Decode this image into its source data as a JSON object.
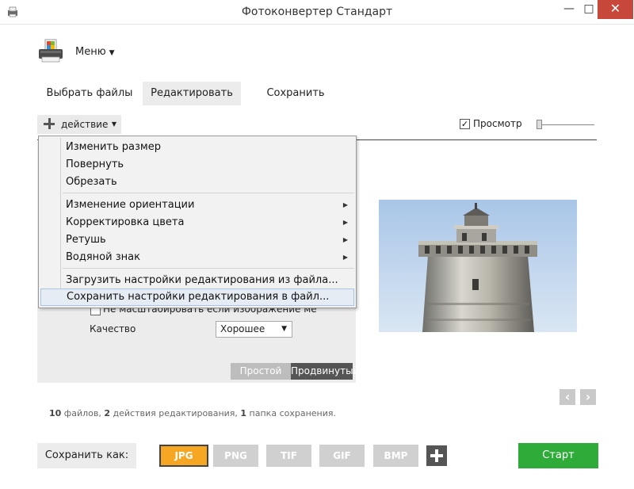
{
  "window": {
    "title": "Фотоконвертер Стандарт",
    "minimize_glyph": "—",
    "maximize_glyph": "□",
    "close_glyph": "✕"
  },
  "header": {
    "menu_label": "Меню",
    "menu_caret": "▼"
  },
  "tabs": [
    {
      "label": "Выбрать файлы",
      "active": false
    },
    {
      "label": "Редактировать",
      "active": true
    },
    {
      "label": "Сохранить",
      "active": false
    }
  ],
  "toolbar": {
    "action_label": "действие",
    "action_caret": "▼",
    "preview_label": "Просмотр",
    "preview_checked": true,
    "preview_check_glyph": "✓"
  },
  "action_menu": {
    "groups": [
      [
        {
          "label": "Изменить размер",
          "submenu": false
        },
        {
          "label": "Повернуть",
          "submenu": false
        },
        {
          "label": "Обрезать",
          "submenu": false
        }
      ],
      [
        {
          "label": "Изменение ориентации",
          "submenu": true
        },
        {
          "label": "Корректировка цвета",
          "submenu": true
        },
        {
          "label": "Ретушь",
          "submenu": true
        },
        {
          "label": "Водяной знак",
          "submenu": true
        }
      ],
      [
        {
          "label": "Загрузить настройки редактирования из файла...",
          "submenu": false
        },
        {
          "label": "Сохранить настройки редактирования в файл...",
          "submenu": false,
          "highlighted": true
        }
      ]
    ],
    "submenu_arrow": "▶"
  },
  "settings": {
    "noscale_label": "Не масштабировать если изображение ме",
    "noscale_checked": false,
    "quality_label": "Качество",
    "quality_value": "Хорошее",
    "quality_caret": "▼",
    "mode_simple": "Простой",
    "mode_advanced": "Продвинутый"
  },
  "nav": {
    "prev_glyph": "‹",
    "next_glyph": "›"
  },
  "summary": {
    "files_count": "10",
    "files_text": " файлов, ",
    "actions_count": "2",
    "actions_text": " действия редактирования, ",
    "folders_count": "1",
    "folders_text": " папка сохранения."
  },
  "save_bar": {
    "save_as_label": "Сохранить как:",
    "formats": [
      {
        "label": "JPG",
        "active": true
      },
      {
        "label": "PNG",
        "active": false
      },
      {
        "label": "TIF",
        "active": false
      },
      {
        "label": "GIF",
        "active": false
      },
      {
        "label": "BMP",
        "active": false
      }
    ],
    "start_label": "Старт"
  },
  "colors": {
    "accent_orange": "#f5a623",
    "start_green": "#2fab3a",
    "close_red": "#c7473b",
    "menu_highlight": "#e6ecf4"
  }
}
